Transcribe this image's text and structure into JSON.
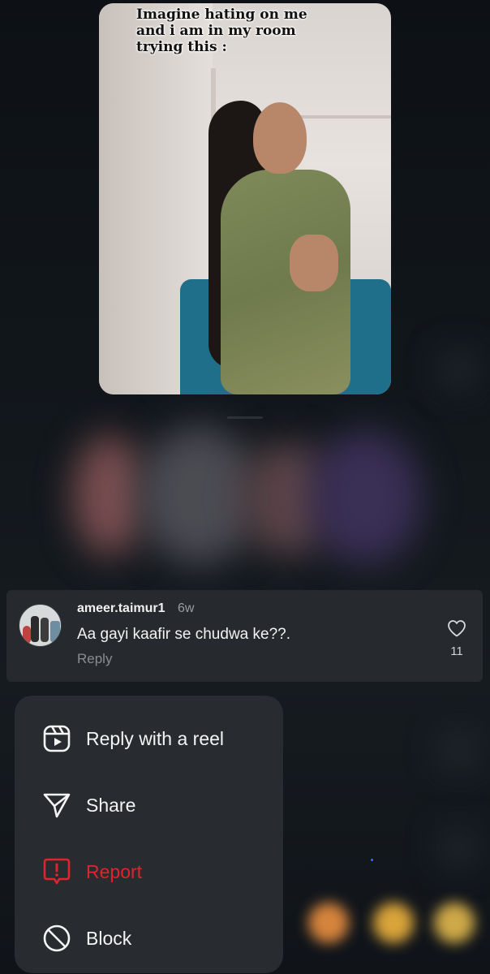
{
  "reel": {
    "caption": "Imagine hating on me\nand i am in my room\ntrying this :"
  },
  "comment": {
    "username": "ameer.taimur1",
    "time": "6w",
    "text": "Aa gayi kaafir se chudwa ke??.",
    "reply_label": "Reply",
    "like_count": "11"
  },
  "menu": {
    "items": [
      {
        "label": "Reply with a reel",
        "icon": "reel-icon"
      },
      {
        "label": "Share",
        "icon": "share-icon"
      },
      {
        "label": "Report",
        "icon": "report-icon",
        "color": "#e0242b"
      },
      {
        "label": "Block",
        "icon": "block-icon"
      }
    ]
  }
}
